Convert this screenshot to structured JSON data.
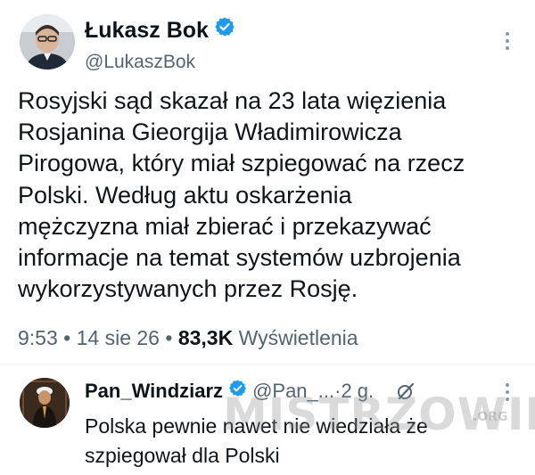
{
  "tweet": {
    "author_name": "Łukasz Bok",
    "author_handle": "@LukaszBok",
    "verified_color": "#1d9bf0",
    "text_lines": [
      "Rosyjski sąd skazał na 23 lata więzienia",
      "Rosjanina Gieorgija Władimirowicza",
      "Pirogowa, który miał szpiegować na rzecz",
      "Polski. Według aktu oskarżenia",
      "mężczyzna miał zbierać i przekazywać",
      "informacje na temat systemów uzbrojenia",
      "wykorzystywanych przez Rosję."
    ],
    "time": "9:53",
    "separator": " • ",
    "date": "14 sie 26",
    "views_count": "83,3K",
    "views_label": "Wyświetlenia",
    "more_icon": "more-vertical-icon"
  },
  "reply": {
    "author_name": "Pan_Windziarz",
    "author_handle": "@Pan_...",
    "separator": " · ",
    "age": "2 g.",
    "text_lines": [
      "Polska pewnie nawet nie wiedziała że",
      "szpiegował dla Polski"
    ],
    "icon": "grok-icon",
    "more_icon": "more-vertical-icon"
  },
  "watermark": {
    "text": "MISTRZOWIE",
    "sub": ".ORG"
  }
}
